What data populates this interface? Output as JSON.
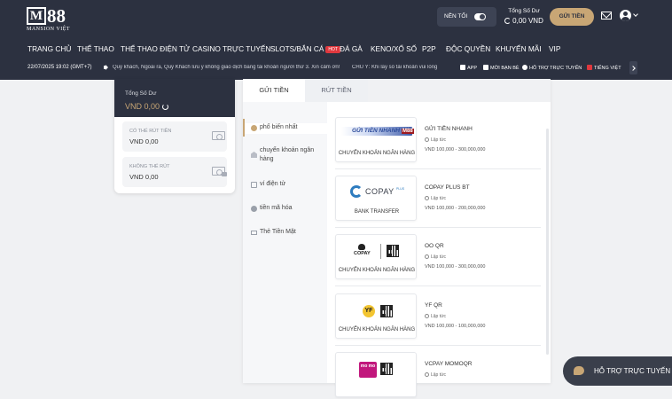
{
  "brand": {
    "logo_mark": "M",
    "logo_num": "88",
    "logo_sub": "MANSION VIỆT"
  },
  "header": {
    "night_mode_label": "NỀN TỐI",
    "balance_label": "Tổng Số Dư",
    "balance_value": "0,00 VND",
    "deposit_button": "GỬI TIỀN",
    "icons": [
      "mail-icon",
      "user-icon",
      "chevron-down-icon"
    ]
  },
  "nav": {
    "items": [
      "TRANG CHỦ",
      "THỂ THAO",
      "THỂ THAO ĐIỆN TỬ",
      "CASINO TRỰC TUYẾN",
      "SLOTS/BẮN CÁ",
      "ĐÁ GÀ",
      "KENO/XỔ SỐ",
      "P2P",
      "ĐỘC QUYỀN",
      "KHUYẾN MÃI",
      "VIP"
    ],
    "hot_badge": "HOT"
  },
  "ticker": {
    "datetime": "22/07/2025 19:02 (GMT+7)",
    "message": "Quý khách, Ngoài ra, Quý Khách lưu ý không giao dịch bằng tài khoản người thứ 3. Xin cảm ơn!",
    "message2": "CHÚ Ý: Khi lấy số tài khoản vui lòng",
    "quick_links": [
      "APP",
      "MỜI BẠN BÈ",
      "HỖ TRỢ TRỰC TUYẾN",
      "TIẾNG VIỆT"
    ]
  },
  "balance_panel": {
    "title": "Tổng Số Dư",
    "total": "VND 0,00",
    "withdrawable_label": "CÓ THỂ RÚT TIỀN",
    "withdrawable_value": "VND 0,00",
    "locked_label": "KHÔNG THỂ RÚT",
    "locked_value": "VND 0,00"
  },
  "tabs": {
    "deposit": "GỬI TIỀN",
    "withdraw": "RÚT TIỀN"
  },
  "side_menu": [
    {
      "label": "phổ biến nhất",
      "icon": "star-icon"
    },
    {
      "label": "chuyển khoản ngân hàng",
      "icon": "bank-icon"
    },
    {
      "label": "ví điện tử",
      "icon": "wallet-icon"
    },
    {
      "label": "tiền mã hóa",
      "icon": "coin-icon"
    },
    {
      "label": "Thẻ Tiền Mặt",
      "icon": "cash-card-icon"
    }
  ],
  "methods": [
    {
      "logo_text": "GỬI TIỀN NHANH",
      "logo_badge": "M88",
      "caption": "CHUYỂN KHOẢN NGÂN HÀNG",
      "name": "GỬI TIỀN NHANH",
      "speed": "Lập tức",
      "range": "VND 100,000 - 300,000,000"
    },
    {
      "logo_text": "COPAY",
      "logo_badge": "PLUS",
      "caption": "BANK TRANSFER",
      "name": "COPAY PLUS BT",
      "speed": "Lập tức",
      "range": "VND 100,000 - 200,000,000"
    },
    {
      "logo_text": "COPAY",
      "logo_badge": "",
      "caption": "CHUYỂN KHOẢN NGÂN HÀNG",
      "name": "OO QR",
      "speed": "Lập tức",
      "range": "VND 100,000 - 300,000,000"
    },
    {
      "logo_text": "YF",
      "logo_badge": "",
      "caption": "CHUYỂN KHOẢN NGÂN HÀNG",
      "name": "YF QR",
      "speed": "Lập tức",
      "range": "VND 100,000 - 100,000,000"
    },
    {
      "logo_text": "mo mo",
      "logo_badge": "",
      "caption": "",
      "name": "VCPAY MOMOQR",
      "speed": "Lập tức",
      "range": ""
    }
  ],
  "support": {
    "label": "HỖ TRỢ TRỰC TUYẾN"
  }
}
